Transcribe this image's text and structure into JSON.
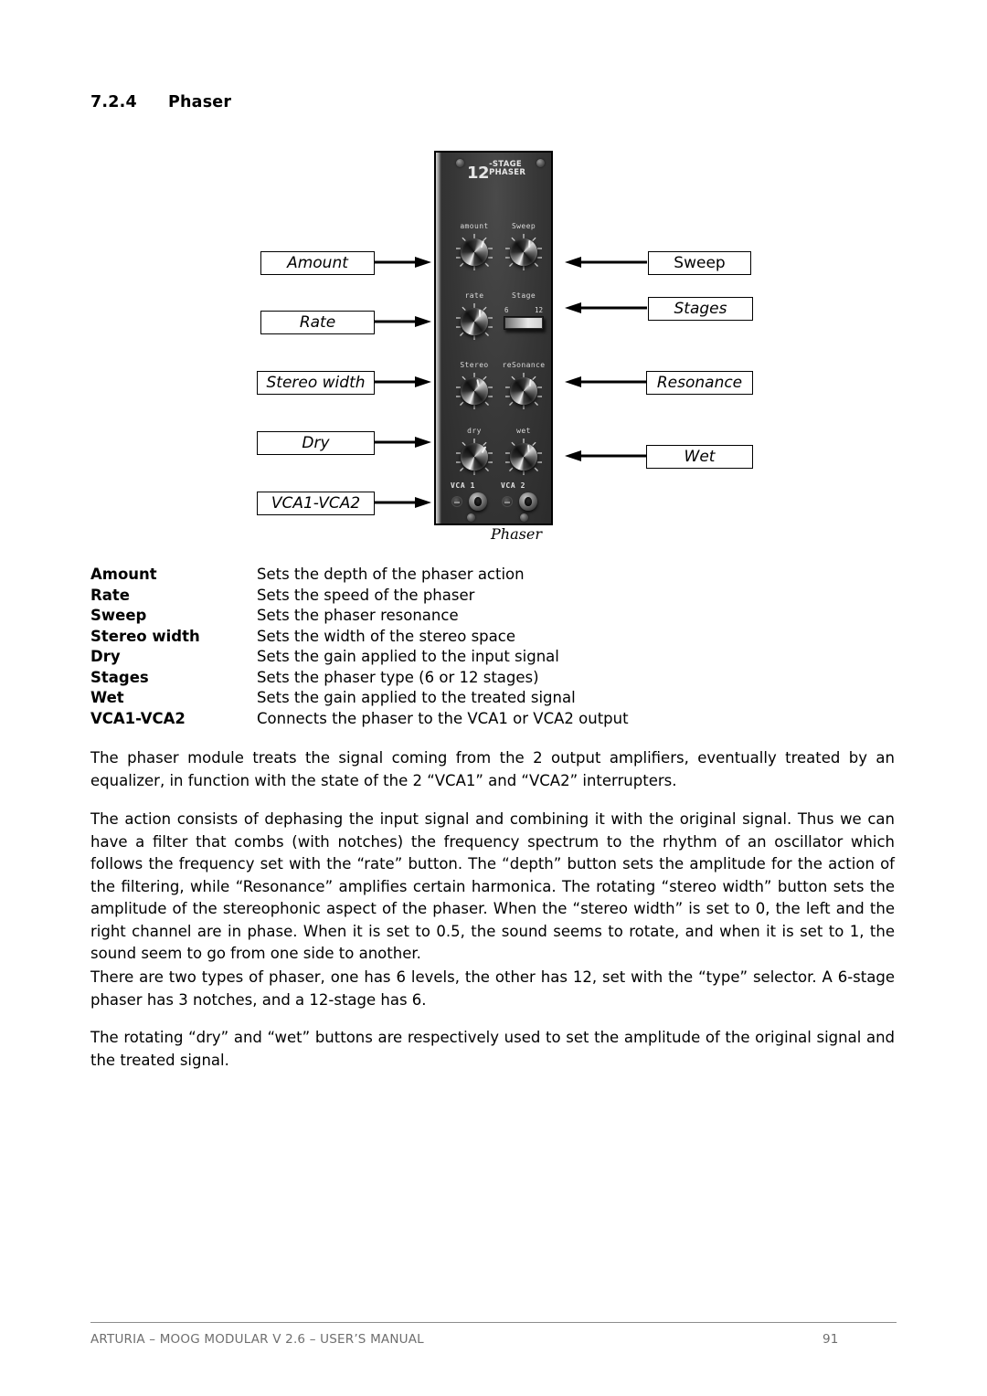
{
  "heading": {
    "number": "7.2.4",
    "title": "Phaser"
  },
  "figure": {
    "caption": "Phaser",
    "module": {
      "brand_big": "12",
      "brand_line1": "-STAGE",
      "brand_line2": "PHASER",
      "knob_labels": {
        "amount": "amount",
        "sweep": "Sweep",
        "rate": "rate",
        "stage": "Stage",
        "stereo": "Stereo",
        "resonance": "reSonance",
        "dry": "dry",
        "wet": "wet"
      },
      "switch": {
        "left_value": "6",
        "right_value": "12"
      },
      "jacks": {
        "vca1": "VCA 1",
        "vca2": "VCA 2"
      }
    },
    "callouts_left": [
      {
        "label": "Amount",
        "italic": true
      },
      {
        "label": "Rate",
        "italic": true
      },
      {
        "label": "Stereo width",
        "italic": true
      },
      {
        "label": "Dry",
        "italic": true
      },
      {
        "label": "VCA1-VCA2",
        "italic": true
      }
    ],
    "callouts_right": [
      {
        "label": "Sweep",
        "italic": false
      },
      {
        "label": "Stages",
        "italic": true
      },
      {
        "label": "Resonance",
        "italic": true
      },
      {
        "label": "Wet",
        "italic": true
      }
    ]
  },
  "definitions": [
    {
      "term": "Amount",
      "desc": "Sets the depth of the phaser action"
    },
    {
      "term": "Rate",
      "desc": "Sets the speed of the phaser"
    },
    {
      "term": "Sweep",
      "desc": "Sets the phaser resonance"
    },
    {
      "term": "Stereo width",
      "desc": "Sets the width of the stereo space"
    },
    {
      "term": "Dry",
      "desc": "Sets the gain applied to the input signal"
    },
    {
      "term": "Stages",
      "desc": "Sets the phaser type (6 or 12 stages)"
    },
    {
      "term": "Wet",
      "desc": "Sets the gain applied to the treated signal"
    },
    {
      "term": "VCA1-VCA2",
      "desc": "Connects the phaser to the VCA1 or VCA2 output"
    }
  ],
  "paragraphs": {
    "p1": "The phaser module treats the signal coming from the 2 output amplifiers, eventually treated by an equalizer, in function with the state of the 2 “VCA1” and “VCA2” interrupters.",
    "p2": "The action consists of dephasing the input signal and combining it with the original signal. Thus we can have a filter that combs (with notches) the frequency spectrum to the rhythm of an oscillator which follows the frequency set with the “rate” button. The “depth” button sets the amplitude for the action of the filtering, while “Resonance” amplifies certain harmonica. The rotating “stereo width” button sets the amplitude of the stereophonic aspect of the phaser. When the “stereo width” is set to 0, the left and the right channel are in phase. When it is set to 0.5, the sound seems to rotate, and when it is set to 1, the sound seem to go from one side to another.",
    "p3": "There are two types of phaser, one has 6 levels, the other has 12, set with the “type” selector. A 6-stage phaser has 3 notches, and a 12-stage has 6.",
    "p4": "The rotating “dry” and “wet” buttons are respectively used to set the amplitude of the original signal and the treated signal."
  },
  "footer": {
    "left": "ARTURIA – MOOG MODULAR V 2.6 – USER’S MANUAL",
    "page": "91"
  }
}
